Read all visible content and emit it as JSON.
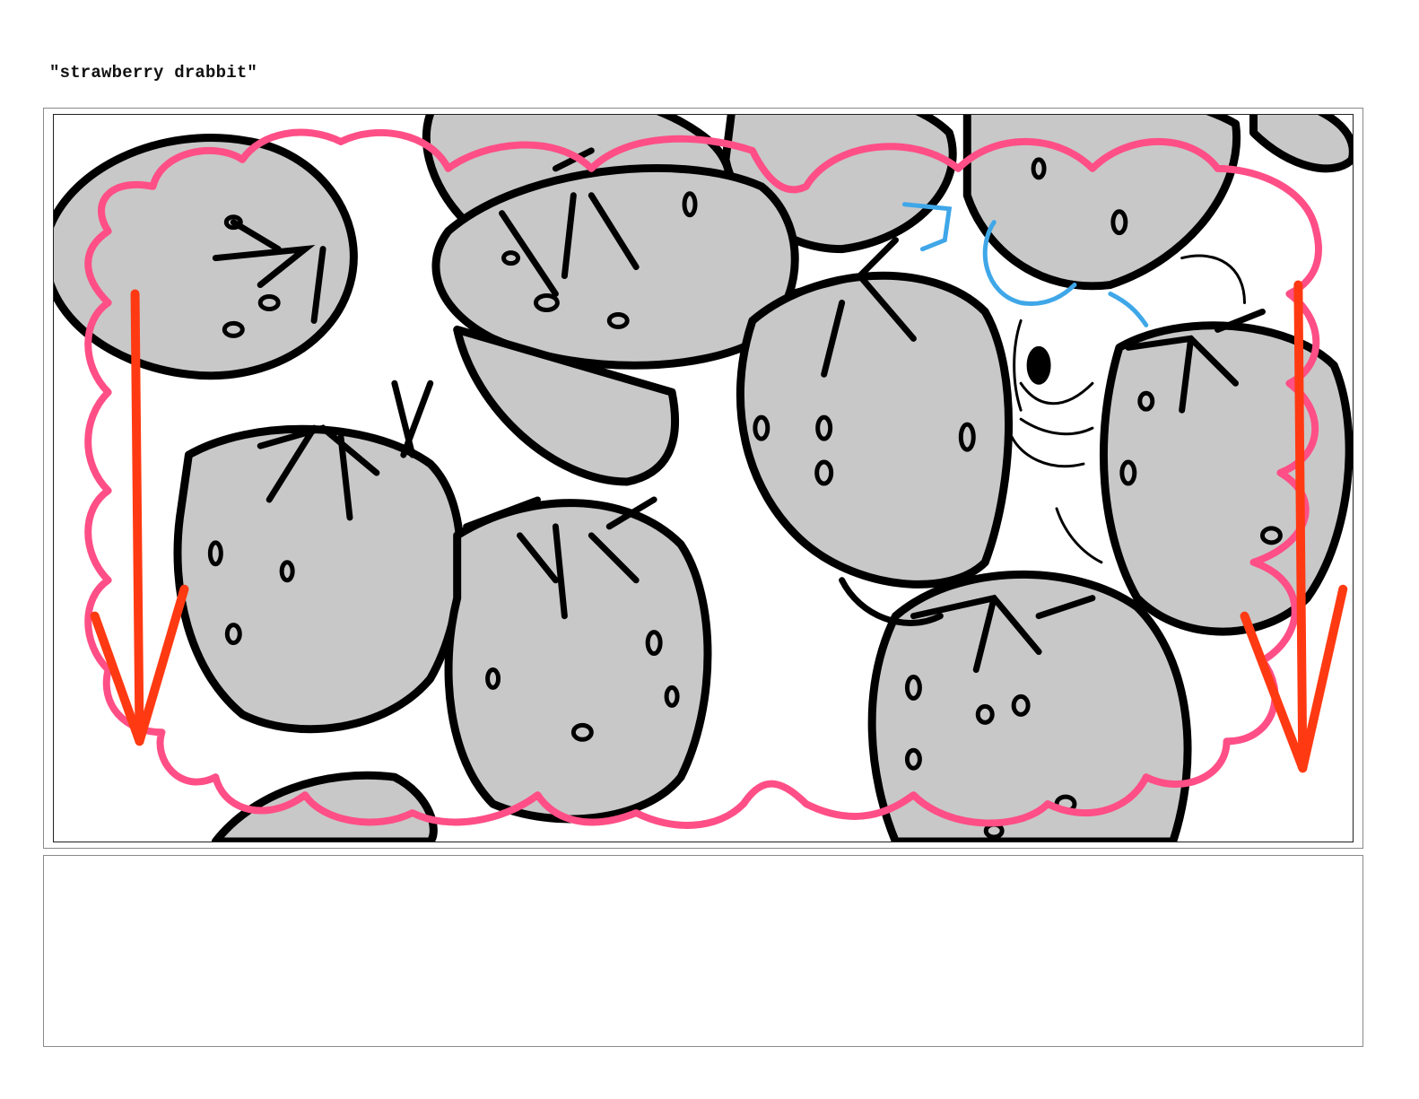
{
  "page": {
    "title": "\"strawberry drabbit\""
  },
  "panel": {
    "icons": [
      "strawberry-cluster-sketch",
      "rabbit-face-sketch",
      "cloud-border",
      "downward-arrow"
    ],
    "colors": {
      "fill": "#c8c8c8",
      "ink": "#000000",
      "cloud": "#ff4f86",
      "arrow": "#ff3a12",
      "accent": "#3fa7e8"
    }
  },
  "notes": {
    "text": ""
  }
}
